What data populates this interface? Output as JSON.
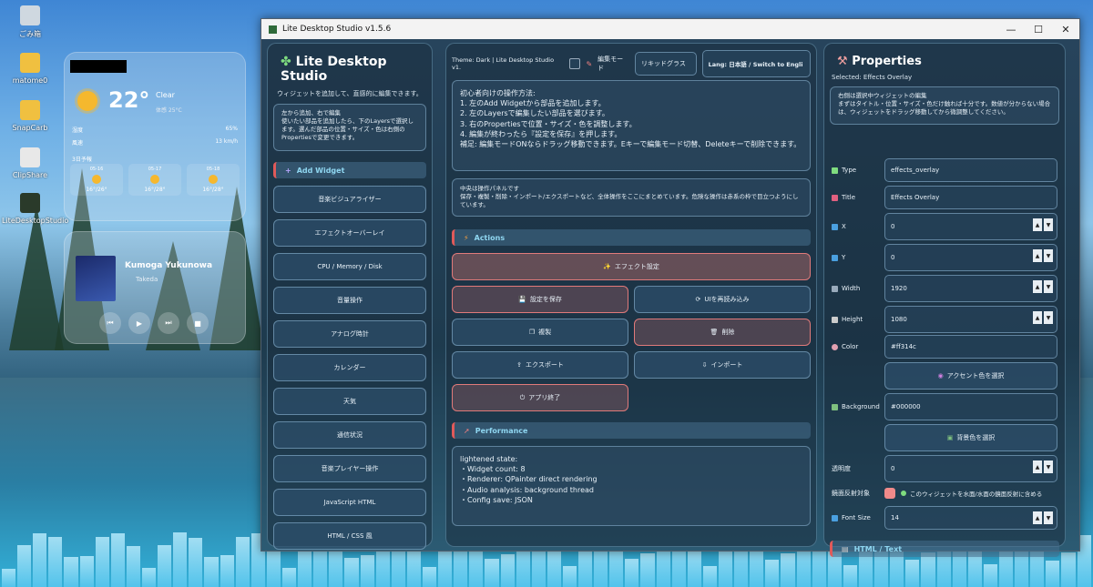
{
  "desktop": {
    "icons": [
      {
        "label": "ごみ箱",
        "icon": "recycle-bin-icon"
      },
      {
        "label": "matome0",
        "icon": "folder-icon"
      },
      {
        "label": "SnapCarb",
        "icon": "folder-icon"
      },
      {
        "label": "ClipShare",
        "icon": "app-icon"
      },
      {
        "label": "LiteDesktopStudio",
        "icon": "app-icon"
      }
    ]
  },
  "weather_widget": {
    "temp": "22°",
    "condition": "Clear",
    "feels": "体感 25°C",
    "humidity_label": "湿度",
    "humidity": "65%",
    "wind_label": "風速",
    "wind": "13 km/h",
    "forecast_title": "3日予報",
    "days": [
      {
        "date": "05-16",
        "range": "16°/26°"
      },
      {
        "date": "05-17",
        "range": "16°/28°"
      },
      {
        "date": "05-18",
        "range": "16°/28°"
      }
    ]
  },
  "music_widget": {
    "title": "Kumoga Yukunowa",
    "artist": "Takeda"
  },
  "window": {
    "title": "Lite Desktop Studio v1.5.6",
    "min": "—",
    "max": "☐",
    "close": "✕"
  },
  "left": {
    "title": "Lite Desktop Studio",
    "subtitle": "ウィジェットを追加して、直感的に編集できます。",
    "info": "左から追加、右で編集\n使いたい部品を追加したら、下のLayersで選択します。選んだ部品の位置・サイズ・色は右側のPropertiesで変更できます。",
    "add_widget": "Add Widget",
    "buttons": [
      "音楽ビジュアライザー",
      "エフェクトオーバーレイ",
      "CPU / Memory / Disk",
      "音量操作",
      "アナログ時計",
      "カレンダー",
      "天気",
      "通信状況",
      "音楽プレイヤー操作",
      "JavaScript HTML",
      "HTML / CSS 風"
    ]
  },
  "mid": {
    "theme": "Theme: Dark | Lite Desktop Studio v1.",
    "edit_mode": "編集モード",
    "style_value": "リキッドグラス",
    "lang_button": "Lang: 日本語 / Switch to Engli",
    "guide_title": "初心者向けの操作方法:",
    "guide_lines": [
      "1. 左のAdd Widgetから部品を追加します。",
      "2. 左のLayersで編集したい部品を選びます。",
      "3. 右のPropertiesで位置・サイズ・色を調整します。",
      "4. 編集が終わったら『設定を保存』を押します。",
      "補足: 編集モードONならドラッグ移動できます。Eキーで編集モード切替、Deleteキーで削除できます。"
    ],
    "note_title": "中央は操作パネルです",
    "note_body": "保存・複製・削除・インポート/エクスポートなど、全体操作をここにまとめています。危険な操作は赤系の枠で目立つようにしています。",
    "actions": "Actions",
    "effect_settings": "エフェクト設定",
    "save": "設定を保存",
    "reload": "UIを再読み込み",
    "duplicate": "複製",
    "delete": "削除",
    "export": "エクスポート",
    "import": "インポート",
    "quit": "アプリ終了",
    "performance": "Performance",
    "perf_lines": [
      "lightened state:",
      "・Widget count: 8",
      "・Renderer: QPainter direct rendering",
      "・Audio analysis: background thread",
      "・Config save: JSON"
    ]
  },
  "right": {
    "title": "Properties",
    "selected": "Selected: Effects Overlay",
    "info": "右側は選択中ウィジェットの編集\nまずはタイトル・位置・サイズ・色だけ触れば十分です。数値が分からない場合は、ウィジェットをドラッグ移動してから微調整してください。",
    "type_label": "Type",
    "type": "effects_overlay",
    "title_label": "Title",
    "title_value": "Effects Overlay",
    "x_label": "X",
    "x": "0",
    "y_label": "Y",
    "y": "0",
    "width_label": "Width",
    "width": "1920",
    "height_label": "Height",
    "height": "1080",
    "color_label": "Color",
    "color": "#ff314c",
    "accent_button": "アクセント色を選択",
    "bg_label": "Background",
    "bg": "#000000",
    "bg_button": "背景色を選択",
    "opacity_label": "透明度",
    "opacity": "0",
    "reflect_label": "鏡面反射対象",
    "reflect_text": "このウィジェットを水面/水面の鏡面反射に含める",
    "fontsize_label": "Font Size",
    "fontsize": "14",
    "html_section": "HTML / Text"
  },
  "colors": {
    "accent": "#e05a5a",
    "title_cyan": "#8fd6f0",
    "color_swatch": "#ff314c"
  }
}
